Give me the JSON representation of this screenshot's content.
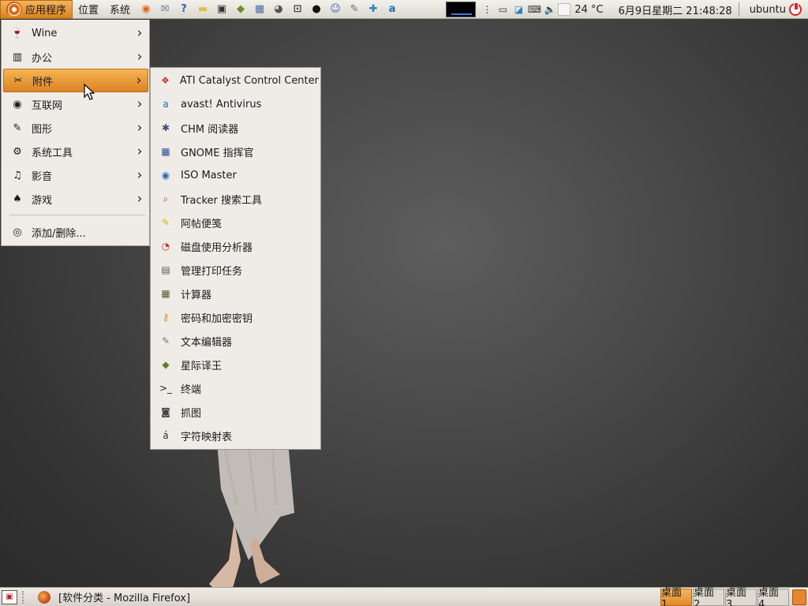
{
  "top_panel": {
    "menus": [
      "应用程序",
      "位置",
      "系统"
    ],
    "launchers": [
      {
        "icon": "firefox-icon",
        "glyph": "◉",
        "color": "#e06a1b"
      },
      {
        "icon": "mail-icon",
        "glyph": "✉",
        "color": "#6d7f9a"
      },
      {
        "icon": "help-icon",
        "glyph": "?",
        "color": "#2c62b8"
      },
      {
        "icon": "folder-icon",
        "glyph": "▬",
        "color": "#e2c044"
      },
      {
        "icon": "terminal-icon",
        "glyph": "▣",
        "color": "#333"
      },
      {
        "icon": "dictionary-icon",
        "glyph": "◆",
        "color": "#6a8f2b"
      },
      {
        "icon": "file-manager-icon",
        "glyph": "▦",
        "color": "#4b6ea9"
      },
      {
        "icon": "eye-icon",
        "glyph": "◕",
        "color": "#555"
      },
      {
        "icon": "screenshot-icon",
        "glyph": "⊡",
        "color": "#444"
      },
      {
        "icon": "qq-penguin-icon",
        "glyph": "●",
        "color": "#111"
      },
      {
        "icon": "users-icon",
        "glyph": "☺",
        "color": "#3b6cb0"
      },
      {
        "icon": "text-editor-icon",
        "glyph": "✎",
        "color": "#6d6a62"
      },
      {
        "icon": "network-icon",
        "glyph": "✚",
        "color": "#2d7fc4"
      },
      {
        "icon": "avast-icon",
        "glyph": "a",
        "color": "#1f6fb7"
      }
    ],
    "temperature": "24 °C",
    "datetime": "6月9日星期二 21:48:28",
    "username": "ubuntu"
  },
  "app_menu": {
    "items": [
      {
        "label": "Wine",
        "icon": "wine-icon",
        "glyph": "🍷",
        "has_submenu": true
      },
      {
        "label": "办公",
        "icon": "office-icon",
        "glyph": "▥",
        "has_submenu": true
      },
      {
        "label": "附件",
        "icon": "accessories-icon",
        "glyph": "✂",
        "has_submenu": true,
        "highlighted": true
      },
      {
        "label": "互联网",
        "icon": "internet-icon",
        "glyph": "◉",
        "has_submenu": true
      },
      {
        "label": "图形",
        "icon": "graphics-icon",
        "glyph": "✎",
        "has_submenu": true
      },
      {
        "label": "系统工具",
        "icon": "system-tools-icon",
        "glyph": "⚙",
        "has_submenu": true
      },
      {
        "label": "影音",
        "icon": "multimedia-icon",
        "glyph": "♫",
        "has_submenu": true
      },
      {
        "label": "游戏",
        "icon": "games-icon",
        "glyph": "♠",
        "has_submenu": true
      }
    ],
    "footer_item": {
      "label": "添加/删除...",
      "icon": "add-remove-icon",
      "glyph": "◎"
    }
  },
  "sub_menu": {
    "items": [
      {
        "label": "ATI Catalyst Control Center",
        "icon": "ati-catalyst-icon",
        "glyph": "❖",
        "color": "#c0392b"
      },
      {
        "label": "avast! Antivirus",
        "icon": "avast-icon",
        "glyph": "a",
        "color": "#1f6fb7"
      },
      {
        "label": "CHM 阅读器",
        "icon": "chm-reader-icon",
        "glyph": "✱",
        "color": "#3a4f7a"
      },
      {
        "label": "GNOME 指挥官",
        "icon": "gnome-commander-icon",
        "glyph": "▦",
        "color": "#2a4e8c"
      },
      {
        "label": "ISO Master",
        "icon": "iso-master-icon",
        "glyph": "◉",
        "color": "#2e67b8"
      },
      {
        "label": "Tracker 搜索工具",
        "icon": "tracker-search-icon",
        "glyph": "⌕",
        "color": "#b33b1b"
      },
      {
        "label": "阿帖便笺",
        "icon": "sticky-notes-icon",
        "glyph": "✎",
        "color": "#d9b800"
      },
      {
        "label": "磁盘使用分析器",
        "icon": "disk-analyzer-icon",
        "glyph": "◔",
        "color": "#c23b2a"
      },
      {
        "label": "管理打印任务",
        "icon": "printer-icon",
        "glyph": "▤",
        "color": "#555"
      },
      {
        "label": "计算器",
        "icon": "calculator-icon",
        "glyph": "▦",
        "color": "#4f5d2f"
      },
      {
        "label": "密码和加密密钥",
        "icon": "keys-icon",
        "glyph": "⚷",
        "color": "#c79a23"
      },
      {
        "label": "文本编辑器",
        "icon": "text-editor-icon",
        "glyph": "✎",
        "color": "#777"
      },
      {
        "label": "星际译王",
        "icon": "stardict-icon",
        "glyph": "◆",
        "color": "#5d7e26"
      },
      {
        "label": "终端",
        "icon": "terminal-icon",
        "glyph": ">_",
        "color": "#222"
      },
      {
        "label": "抓图",
        "icon": "camera-icon",
        "glyph": "◙",
        "color": "#444"
      },
      {
        "label": "字符映射表",
        "icon": "character-map-icon",
        "glyph": "á",
        "color": "#333"
      }
    ]
  },
  "bottom_panel": {
    "task_title": "[软件分类 - Mozilla Firefox]",
    "workspaces": [
      "桌面 1",
      "桌面 2",
      "桌面 3",
      "桌面 4"
    ],
    "active_workspace_index": 0
  },
  "colors": {
    "highlight": "#e08b2c",
    "panel": "#e6e2da",
    "menu_bg": "#efebe7"
  }
}
